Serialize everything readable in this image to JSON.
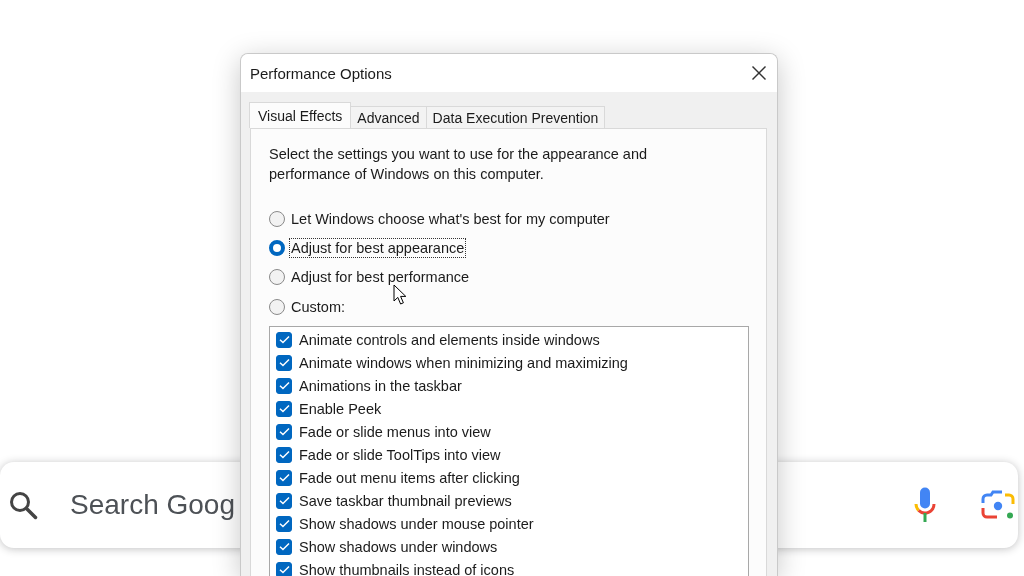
{
  "search_bar": {
    "placeholder": "Search Goog"
  },
  "dialog": {
    "title": "Performance Options",
    "tabs": [
      {
        "label": "Visual Effects",
        "selected": true
      },
      {
        "label": "Advanced",
        "selected": false
      },
      {
        "label": "Data Execution Prevention",
        "selected": false
      }
    ],
    "description": "Select the settings you want to use for the appearance and performance of Windows on this computer.",
    "options": [
      {
        "label": "Let Windows choose what's best for my computer",
        "selected": false,
        "focused": false
      },
      {
        "label": "Adjust for best appearance",
        "selected": true,
        "focused": true
      },
      {
        "label": "Adjust for best performance",
        "selected": false,
        "focused": false
      },
      {
        "label": "Custom:",
        "selected": false,
        "focused": false
      }
    ],
    "effects": [
      {
        "label": "Animate controls and elements inside windows",
        "checked": true
      },
      {
        "label": "Animate windows when minimizing and maximizing",
        "checked": true
      },
      {
        "label": "Animations in the taskbar",
        "checked": true
      },
      {
        "label": "Enable Peek",
        "checked": true
      },
      {
        "label": "Fade or slide menus into view",
        "checked": true
      },
      {
        "label": "Fade or slide ToolTips into view",
        "checked": true
      },
      {
        "label": "Fade out menu items after clicking",
        "checked": true
      },
      {
        "label": "Save taskbar thumbnail previews",
        "checked": true
      },
      {
        "label": "Show shadows under mouse pointer",
        "checked": true
      },
      {
        "label": "Show shadows under windows",
        "checked": true
      },
      {
        "label": "Show thumbnails instead of icons",
        "checked": true
      }
    ]
  }
}
